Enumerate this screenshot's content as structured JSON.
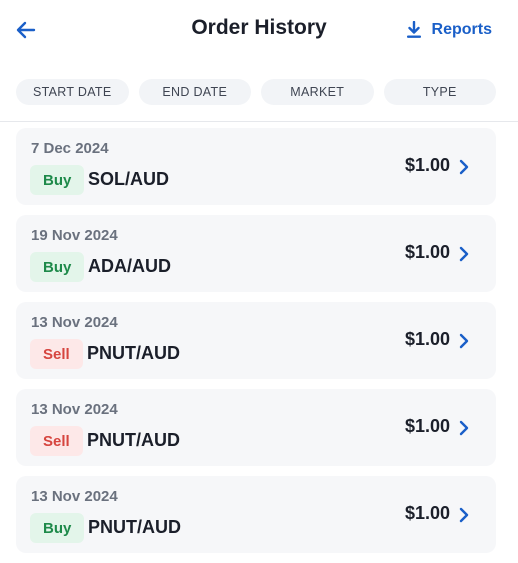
{
  "header": {
    "title": "Order History",
    "reports_label": "Reports"
  },
  "filters": [
    "START DATE",
    "END DATE",
    "MARKET",
    "TYPE"
  ],
  "orders": [
    {
      "date": "7 Dec 2024",
      "side": "Buy",
      "pair": "SOL/AUD",
      "amount": "$1.00"
    },
    {
      "date": "19 Nov 2024",
      "side": "Buy",
      "pair": "ADA/AUD",
      "amount": "$1.00"
    },
    {
      "date": "13 Nov 2024",
      "side": "Sell",
      "pair": "PNUT/AUD",
      "amount": "$1.00"
    },
    {
      "date": "13 Nov 2024",
      "side": "Sell",
      "pair": "PNUT/AUD",
      "amount": "$1.00"
    },
    {
      "date": "13 Nov 2024",
      "side": "Buy",
      "pair": "PNUT/AUD",
      "amount": "$1.00"
    }
  ],
  "colors": {
    "accent": "#1a5fc8",
    "buy_text": "#1e8a4a",
    "buy_bg": "#e3f5ea",
    "sell_text": "#d6453f",
    "sell_bg": "#fde8e8"
  }
}
